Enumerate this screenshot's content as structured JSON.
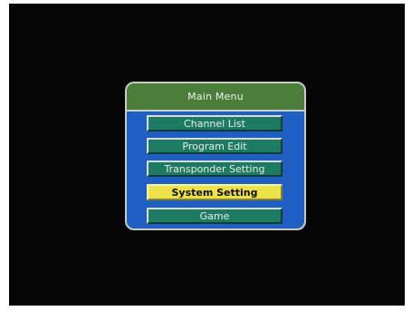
{
  "main_menu": {
    "title": "Main Menu",
    "items": [
      {
        "label": "Channel List",
        "selected": false
      },
      {
        "label": "Program Edit",
        "selected": false
      },
      {
        "label": "Transponder Setting",
        "selected": false
      },
      {
        "label": "System Setting",
        "selected": true
      },
      {
        "label": "Game",
        "selected": false
      }
    ]
  },
  "colors": {
    "screen_background": "#050505",
    "menu_panel": "#1f5fc4",
    "header": "#4b7e3b",
    "item": "#1d7b63",
    "item_selected": "#ece24a"
  }
}
